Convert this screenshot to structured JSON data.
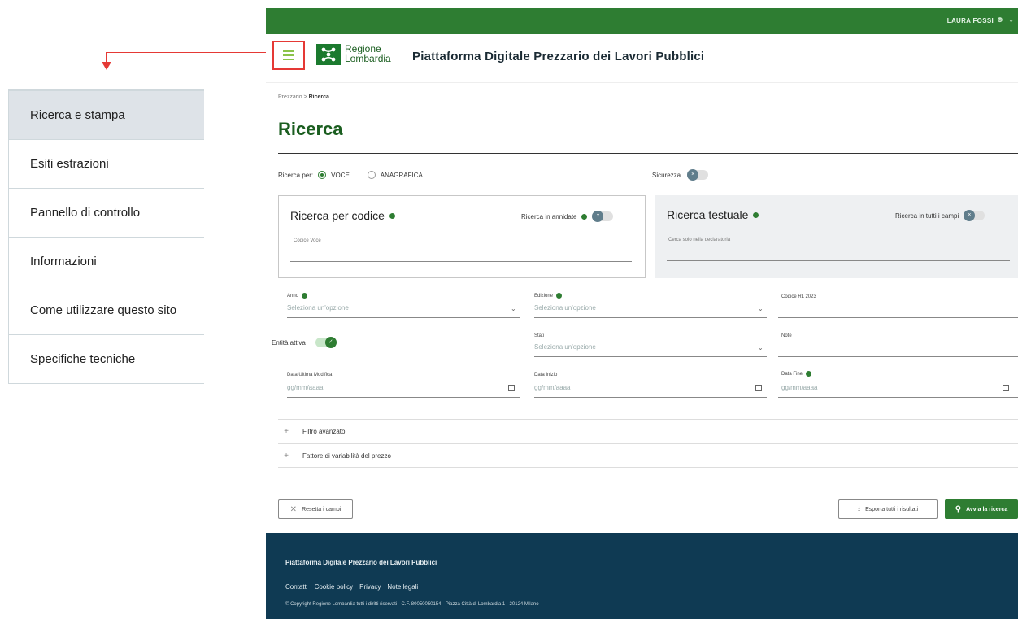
{
  "sidemenu": {
    "items": [
      {
        "label": "Ricerca e stampa",
        "active": true
      },
      {
        "label": "Esiti estrazioni"
      },
      {
        "label": "Pannello di controllo"
      },
      {
        "label": "Informazioni"
      },
      {
        "label": "Come utilizzare questo sito"
      },
      {
        "label": "Specifiche tecniche"
      }
    ]
  },
  "topbar": {
    "user_name": "LAURA FOSSI"
  },
  "header": {
    "logo_line1": "Regione",
    "logo_line2": "Lombardia",
    "title": "Piattaforma Digitale Prezzario dei Lavori Pubblici"
  },
  "breadcrumb": {
    "parent": "Prezzario",
    "separator": ">",
    "current": "Ricerca"
  },
  "page_title": "Ricerca",
  "search_by": {
    "label": "Ricerca per:",
    "options": [
      {
        "label": "VOCE",
        "selected": true
      },
      {
        "label": "ANAGRAFICA",
        "selected": false
      }
    ]
  },
  "sicurezza": {
    "label": "Sicurezza",
    "on": false
  },
  "code_box": {
    "title": "Ricerca per codice",
    "option_label": "Ricerca in annidate",
    "field_label": "Codice Voce"
  },
  "text_box": {
    "title": "Ricerca testuale",
    "option_label": "Ricerca in tutti i campi",
    "field_label": "Cerca solo nella declaratoria"
  },
  "form": {
    "anno_label": "Anno",
    "edizione_label": "Edizione",
    "codice_rl_label": "Codice RL 2023",
    "select_placeholder": "Seleziona un'opzione",
    "entita_label": "Entità attiva",
    "stati_label": "Stati",
    "note_label": "Note",
    "data_ultima_label": "Data Ultima Modifica",
    "data_inizio_label": "Data Inizio",
    "data_fine_label": "Data Fine",
    "date_placeholder": "gg/mm/aaaa"
  },
  "accordion": [
    {
      "label": "Filtro avanzato"
    },
    {
      "label": "Fattore di variabilità del prezzo"
    }
  ],
  "buttons": {
    "reset": "Resetta i campi",
    "export": "Esporta tutti i risultati",
    "search": "Avvia la ricerca"
  },
  "footer": {
    "title": "Piattaforma Digitale Prezzario dei Lavori Pubblici",
    "links": [
      "Contatti",
      "Cookie policy",
      "Privacy",
      "Note legali"
    ],
    "copyright": "© Copyright Regione Lombardia tutti i diritti riservati - C.F. 80050050154 - Piazza Città di Lombardia 1 - 20124 Milano"
  },
  "colors": {
    "brand_green": "#2e7d32",
    "footer_blue": "#0f3a53",
    "annotation_red": "#e53935"
  }
}
